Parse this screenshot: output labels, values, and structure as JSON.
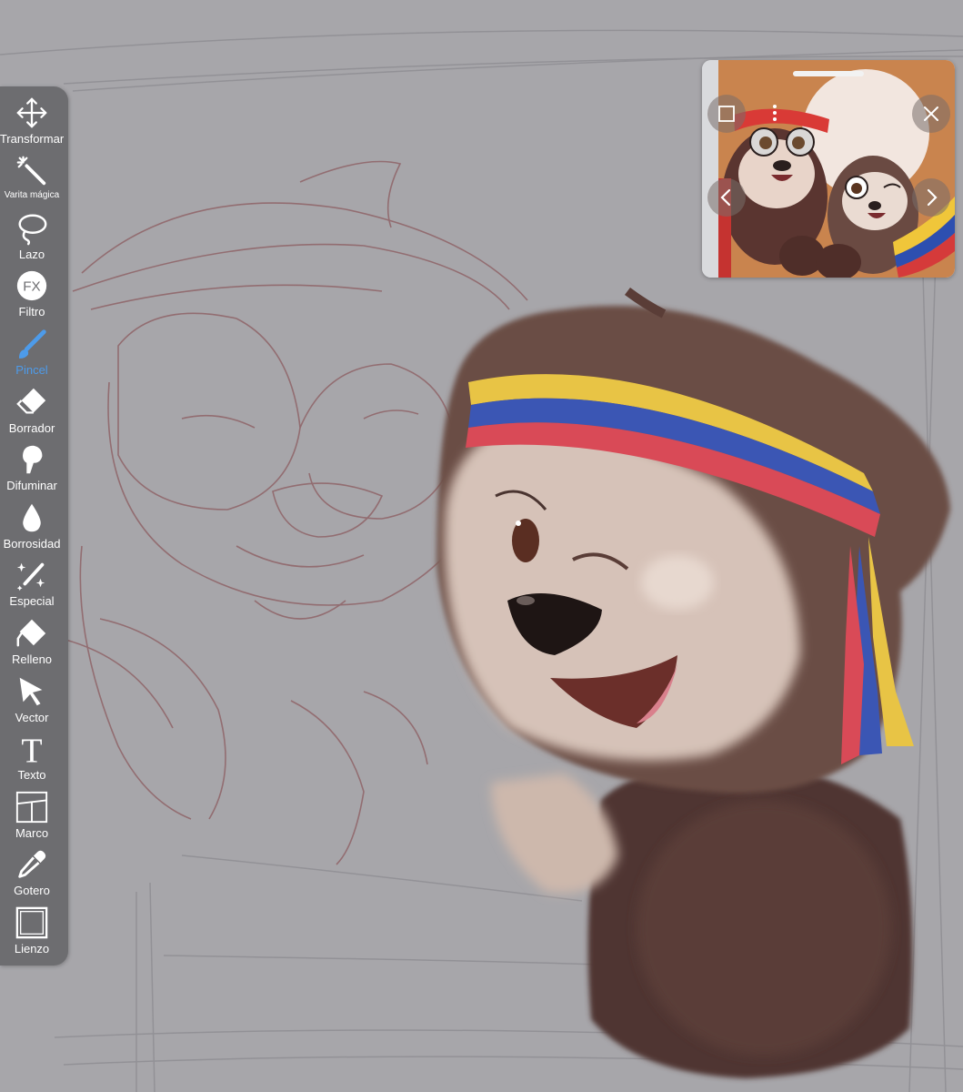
{
  "toolbar": {
    "tools": [
      {
        "label": "Transformar",
        "icon": "move-arrows-icon"
      },
      {
        "label": "Varita mágica",
        "icon": "magic-wand-icon"
      },
      {
        "label": "Lazo",
        "icon": "lasso-icon"
      },
      {
        "label": "Filtro",
        "icon": "fx-icon"
      },
      {
        "label": "Pincel",
        "icon": "brush-icon",
        "active": true
      },
      {
        "label": "Borrador",
        "icon": "eraser-icon"
      },
      {
        "label": "Difuminar",
        "icon": "smudge-finger-icon"
      },
      {
        "label": "Borrosidad",
        "icon": "blur-drop-icon"
      },
      {
        "label": "Especial",
        "icon": "sparkle-brush-icon"
      },
      {
        "label": "Relleno",
        "icon": "fill-bucket-icon"
      },
      {
        "label": "Vector",
        "icon": "arrow-cursor-icon"
      },
      {
        "label": "Texto",
        "icon": "text-icon"
      },
      {
        "label": "Marco",
        "icon": "frame-panels-icon"
      },
      {
        "label": "Gotero",
        "icon": "eyedropper-icon"
      },
      {
        "label": "Lienzo",
        "icon": "canvas-square-icon"
      }
    ],
    "active_color": "#4d9bea"
  },
  "reference_window": {
    "buttons": [
      "square-icon",
      "more-dots-icon",
      "close-icon",
      "chevron-left-icon",
      "chevron-right-icon"
    ]
  },
  "colors": {
    "canvas_bg": "#a7a6aa",
    "toolbar_bg": "#6d6d70",
    "fur": "#5a4039",
    "face": "#d9c6bb",
    "flag_yellow": "#e8c445",
    "flag_blue": "#3b56b4",
    "flag_red": "#d94a57"
  }
}
